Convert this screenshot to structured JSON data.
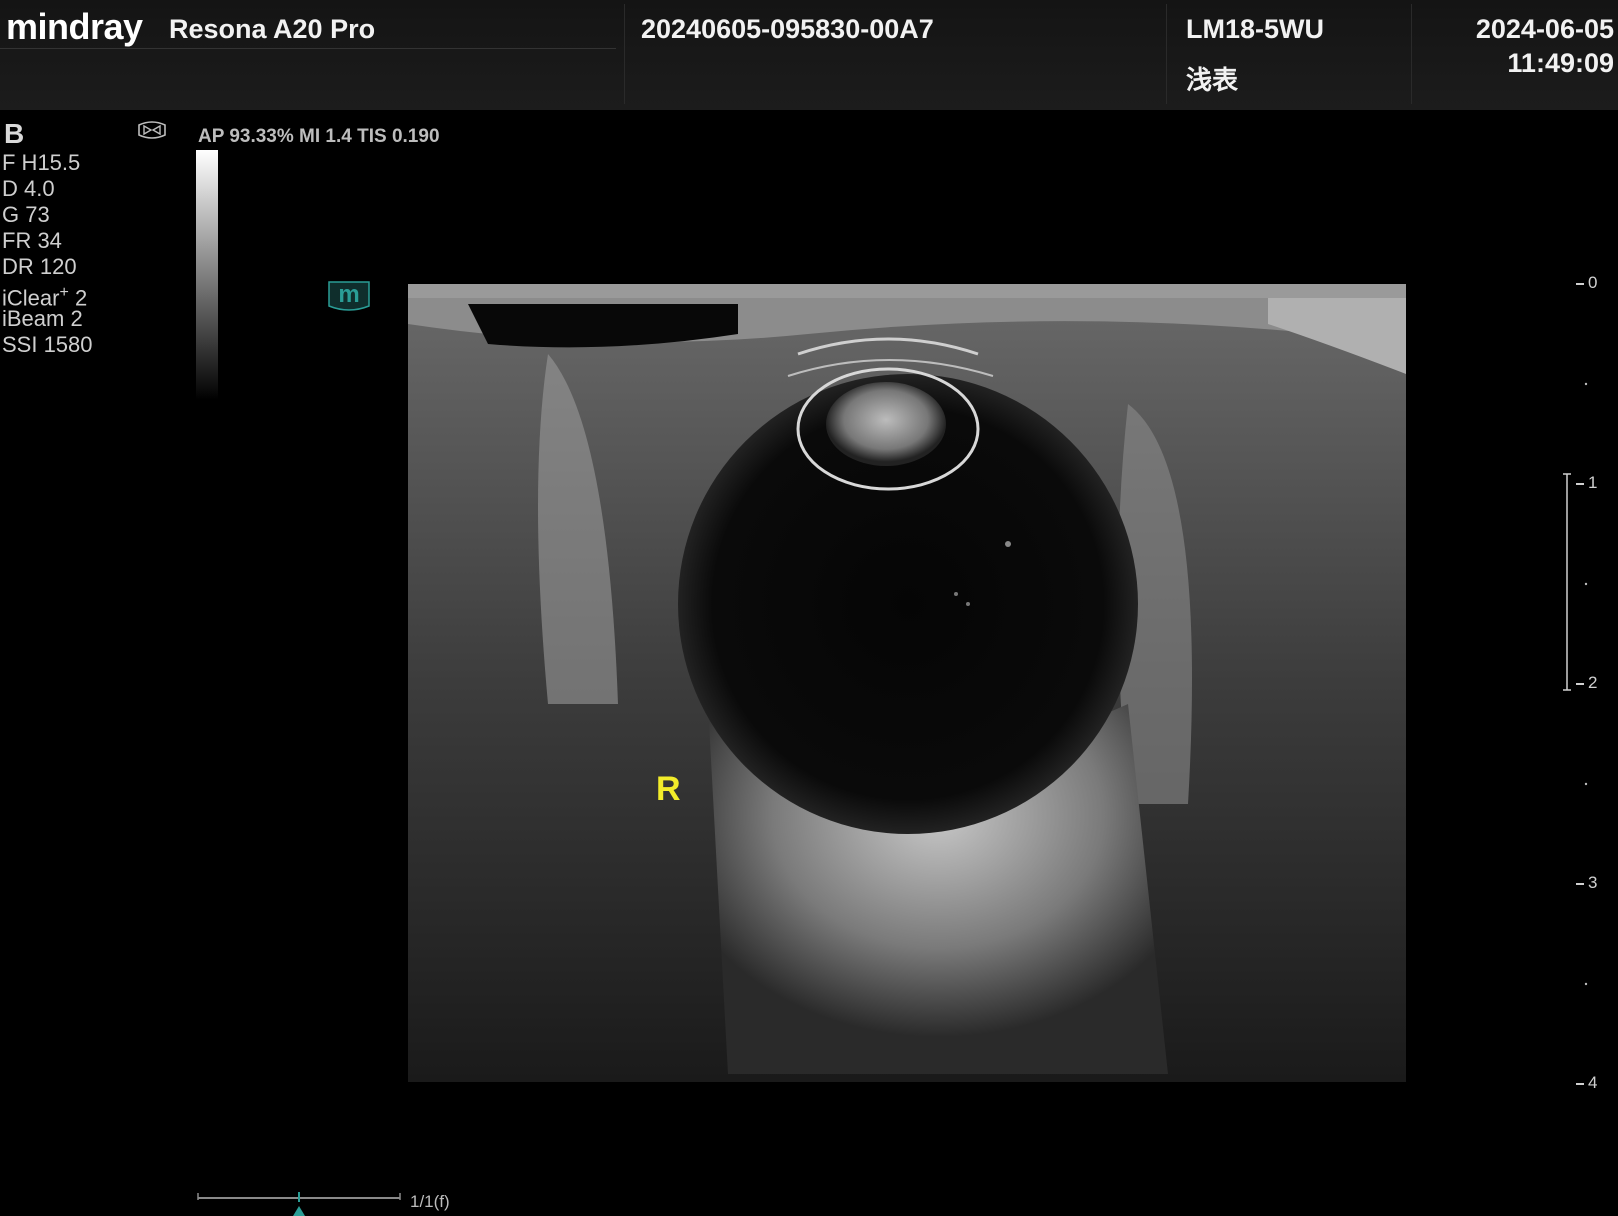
{
  "header": {
    "brand": "mindray",
    "model": "Resona A20 Pro",
    "exam_id": "20240605-095830-00A7",
    "probe": "LM18-5WU",
    "preset": "浅表",
    "date": "2024-06-05",
    "time": "11:49:09"
  },
  "imaging": {
    "mode": "B",
    "params": [
      "F H15.5",
      "D 4.0",
      "G 73",
      "FR 34",
      "DR 120",
      "iBeam 2",
      "SSI 1580"
    ],
    "iclear_label": "iClear",
    "iclear_sup": "+",
    "iclear_value": "2",
    "acoustic_output": "AP 93.33%  MI 1.4 TIS 0.190",
    "marker_letter": "m"
  },
  "image": {
    "orientation_label": "R"
  },
  "depth_scale": {
    "labels": [
      "0",
      "1",
      "2",
      "3",
      "4"
    ]
  },
  "cine": {
    "frame_text": "1/1(f)"
  },
  "colors": {
    "orientation_label": "#f2ec2a",
    "marker_teal": "#2a9d96"
  },
  "icons": {
    "orientation_icon": "probe-orientation-icon",
    "marker_icon": "m-marker-icon"
  }
}
